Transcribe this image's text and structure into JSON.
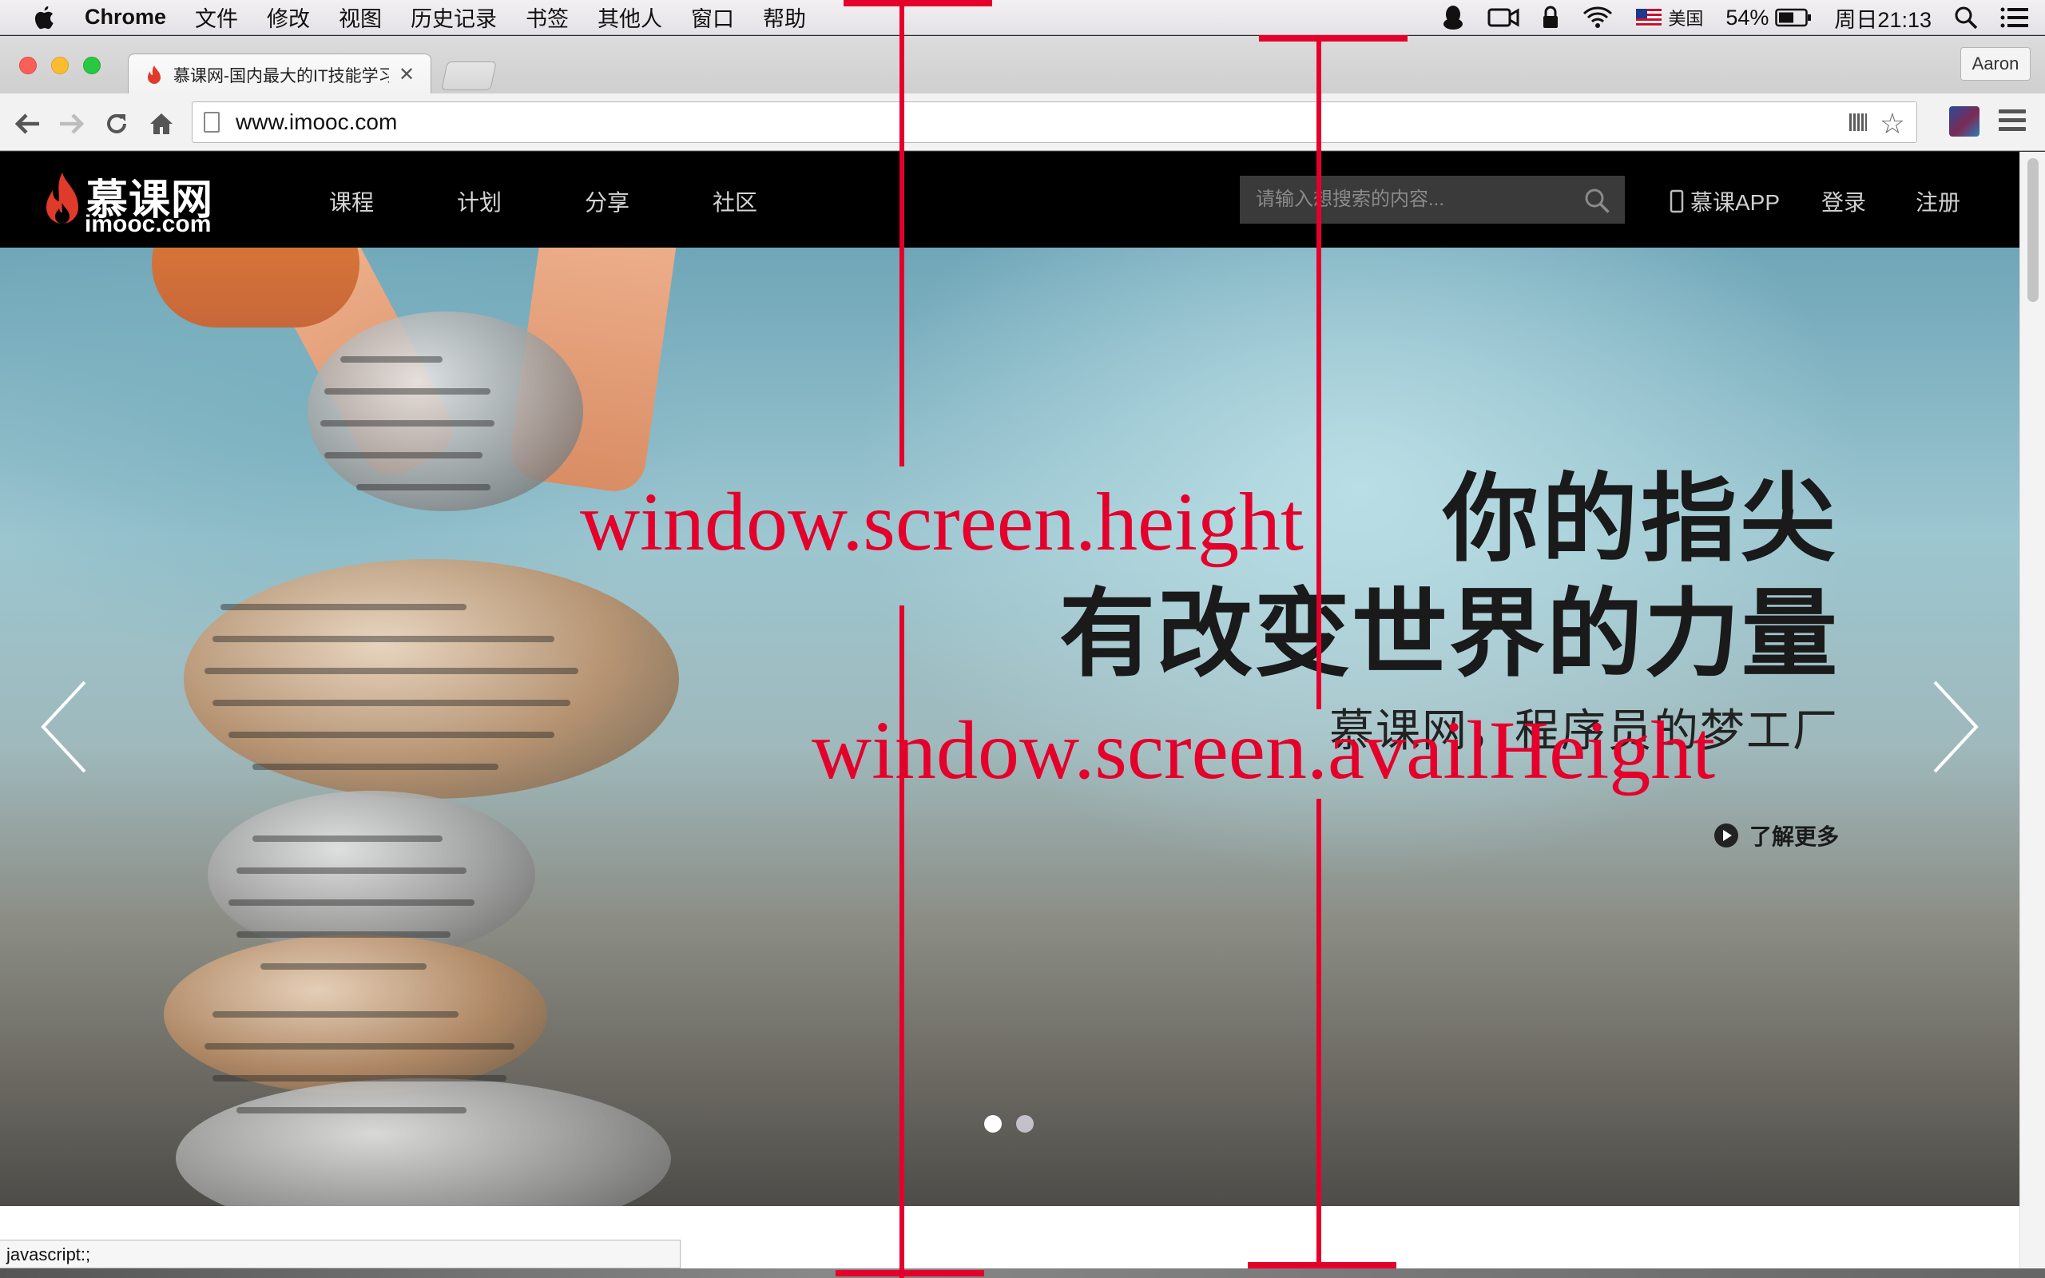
{
  "menubar": {
    "app": "Chrome",
    "items": [
      "文件",
      "修改",
      "视图",
      "历史记录",
      "书签",
      "其他人",
      "窗口",
      "帮助"
    ],
    "input_source": "美国",
    "battery": "54%",
    "clock": "周日21:13"
  },
  "browser": {
    "tab_title": "慕课网-国内最大的IT技能学习平台",
    "profile": "Aaron",
    "url": "www.imooc.com",
    "status_url": "javascript:;"
  },
  "site": {
    "logo_cn": "慕课网",
    "logo_en": "imooc.com",
    "nav": [
      "课程",
      "计划",
      "分享",
      "社区"
    ],
    "search_placeholder": "请输入想搜索的内容...",
    "app_link": "慕课APP",
    "login": "登录",
    "register": "注册"
  },
  "banner": {
    "headline_1": "你的指尖",
    "headline_2": "有改变世界的力量",
    "subline": "慕课网，程序员的梦工厂",
    "learn_more": "了解更多",
    "slide_count": 2,
    "active_slide": 1
  },
  "annotations": {
    "label_1": "window.screen.height",
    "label_2": "window.screen.availHeight",
    "color": "#e4002b"
  },
  "colors": {
    "header_bg": "#000000",
    "accent_red": "#e4002b"
  }
}
